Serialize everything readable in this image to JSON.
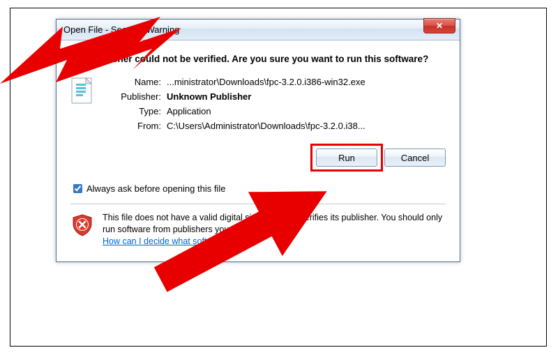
{
  "dialog": {
    "title": "Open File - Security Warning",
    "heading": "The publisher could not be verified.  Are you sure you want to run this software?",
    "fields": {
      "name_label": "Name:",
      "name_value": "...ministrator\\Downloads\\fpc-3.2.0.i386-win32.exe",
      "publisher_label": "Publisher:",
      "publisher_value": "Unknown Publisher",
      "type_label": "Type:",
      "type_value": "Application",
      "from_label": "From:",
      "from_value": "C:\\Users\\Administrator\\Downloads\\fpc-3.2.0.i38..."
    },
    "buttons": {
      "run": "Run",
      "cancel": "Cancel"
    },
    "checkbox_label": "Always ask before opening this file",
    "footer": {
      "text1": "This file does not have a valid digital signature that verifies its publisher.  You should only run software from publishers you trust.",
      "link": "How can I decide what software to run?"
    }
  },
  "annotation": {
    "arrow_color": "#e80000"
  }
}
